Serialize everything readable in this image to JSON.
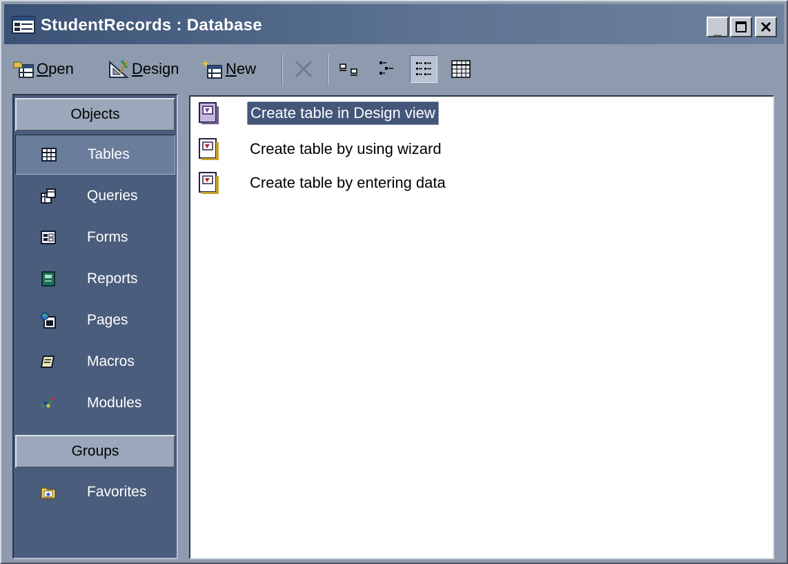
{
  "window": {
    "title": "StudentRecords : Database",
    "title_icon": "database-window-icon",
    "controls": {
      "minimize": "_",
      "maximize": "□",
      "close": "×"
    }
  },
  "toolbar": {
    "open_label": "Open",
    "open_accel": "O",
    "design_label": "Design",
    "design_accel": "D",
    "new_label": "New",
    "new_accel": "N",
    "buttons": [
      "delete-icon",
      "large-icons-view-icon",
      "small-icons-view-icon",
      "list-view-icon",
      "details-view-icon"
    ],
    "active_view": "list"
  },
  "objects_bar": {
    "objects_header": "Objects",
    "groups_header": "Groups",
    "items": [
      {
        "label": "Tables",
        "icon": "table-icon"
      },
      {
        "label": "Queries",
        "icon": "query-icon"
      },
      {
        "label": "Forms",
        "icon": "form-icon"
      },
      {
        "label": "Reports",
        "icon": "report-icon"
      },
      {
        "label": "Pages",
        "icon": "page-icon"
      },
      {
        "label": "Macros",
        "icon": "macro-icon"
      },
      {
        "label": "Modules",
        "icon": "module-icon"
      }
    ],
    "selected": "Tables",
    "groups": [
      {
        "label": "Favorites",
        "icon": "favorites-folder-icon"
      }
    ]
  },
  "list": {
    "items": [
      {
        "label": "Create table in Design view"
      },
      {
        "label": "Create table by using wizard"
      },
      {
        "label": "Create table by entering data"
      }
    ],
    "selected_index": 0
  },
  "colors": {
    "window_bg": "#8E9BAE",
    "title_bar": "#3B5276",
    "objects_bar_bg": "#4A5D7C",
    "selection": "#44577A"
  }
}
